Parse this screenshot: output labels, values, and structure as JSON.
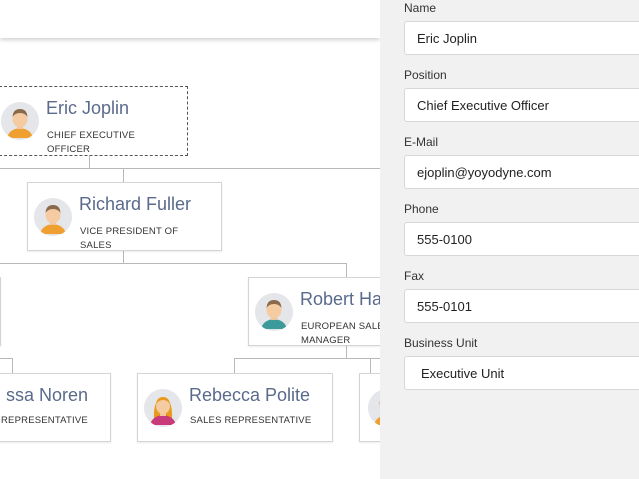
{
  "orgchart": {
    "nodes": [
      {
        "name": "Eric Joplin",
        "title_line1": "CHIEF EXECUTIVE",
        "title_line2": "OFFICER"
      },
      {
        "name": "Richard Fuller",
        "title_line1": "VICE PRESIDENT OF",
        "title_line2": "SALES"
      },
      {
        "name": "Robert Ha",
        "title_line1": "EUROPEAN SALE",
        "title_line2": "MANAGER"
      },
      {
        "name": "ssa Noren",
        "title_line1": "REPRESENTATIVE",
        "title_line2": ""
      },
      {
        "name": "Rebecca Polite",
        "title_line1": "SALES REPRESENTATIVE",
        "title_line2": ""
      }
    ]
  },
  "form": {
    "fields": [
      {
        "label": "Name",
        "value": "Eric Joplin"
      },
      {
        "label": "Position",
        "value": "Chief Executive Officer"
      },
      {
        "label": "E-Mail",
        "value": "ejoplin@yoyodyne.com"
      },
      {
        "label": "Phone",
        "value": "555-0100"
      },
      {
        "label": "Fax",
        "value": "555-0101"
      },
      {
        "label": "Business Unit",
        "value": "Executive Unit"
      }
    ]
  }
}
